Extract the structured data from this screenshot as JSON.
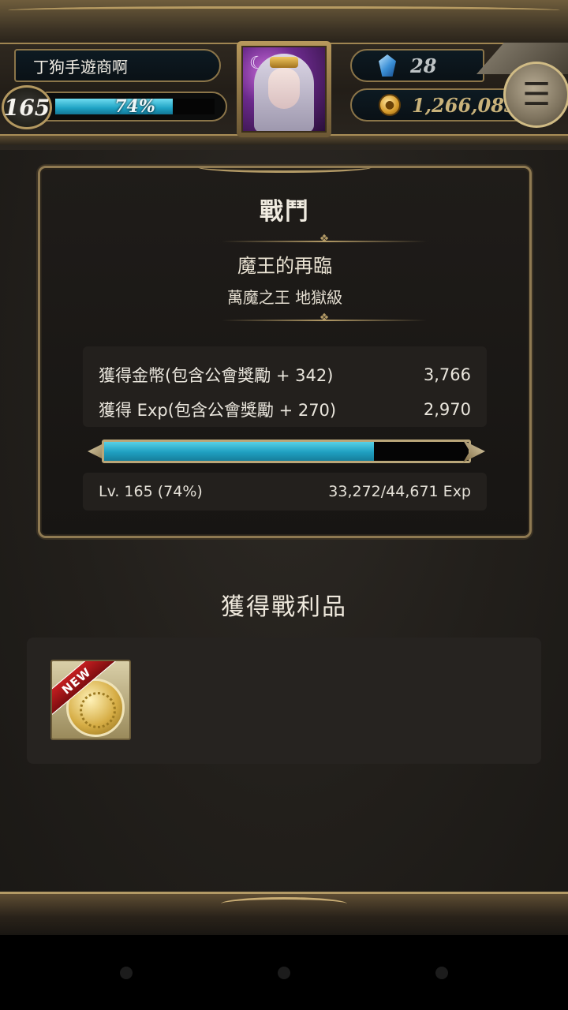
{
  "player": {
    "name": "丁狗手遊商啊",
    "level": "165",
    "level_percent_label": "74%",
    "level_progress": 0.74
  },
  "currency": {
    "gems": "28",
    "gold": "1,266,083",
    "gem_icon": "blue-crystal-icon",
    "gold_icon": "gold-coin-icon"
  },
  "battle": {
    "title": "戰鬥",
    "stage_name": "魔王的再臨",
    "stage_sub": "萬魔之王 地獄級",
    "rewards": [
      {
        "label": "獲得金幣(包含公會獎勵 + 342)",
        "value": "3,766"
      },
      {
        "label": "獲得 Exp(包含公會獎勵 + 270)",
        "value": "2,970"
      }
    ],
    "exp_progress": 0.74,
    "level_info": "Lv. 165 (74%)",
    "exp_info": "33,272/44,671 Exp"
  },
  "loot": {
    "title": "獲得戰利品",
    "items": [
      {
        "name": "gold-coin-card",
        "badge": "NEW"
      }
    ]
  },
  "colors": {
    "accent_gold": "#b39a66",
    "exp_blue": "#1f9fc0",
    "panel_bg": "#1f1c19"
  }
}
